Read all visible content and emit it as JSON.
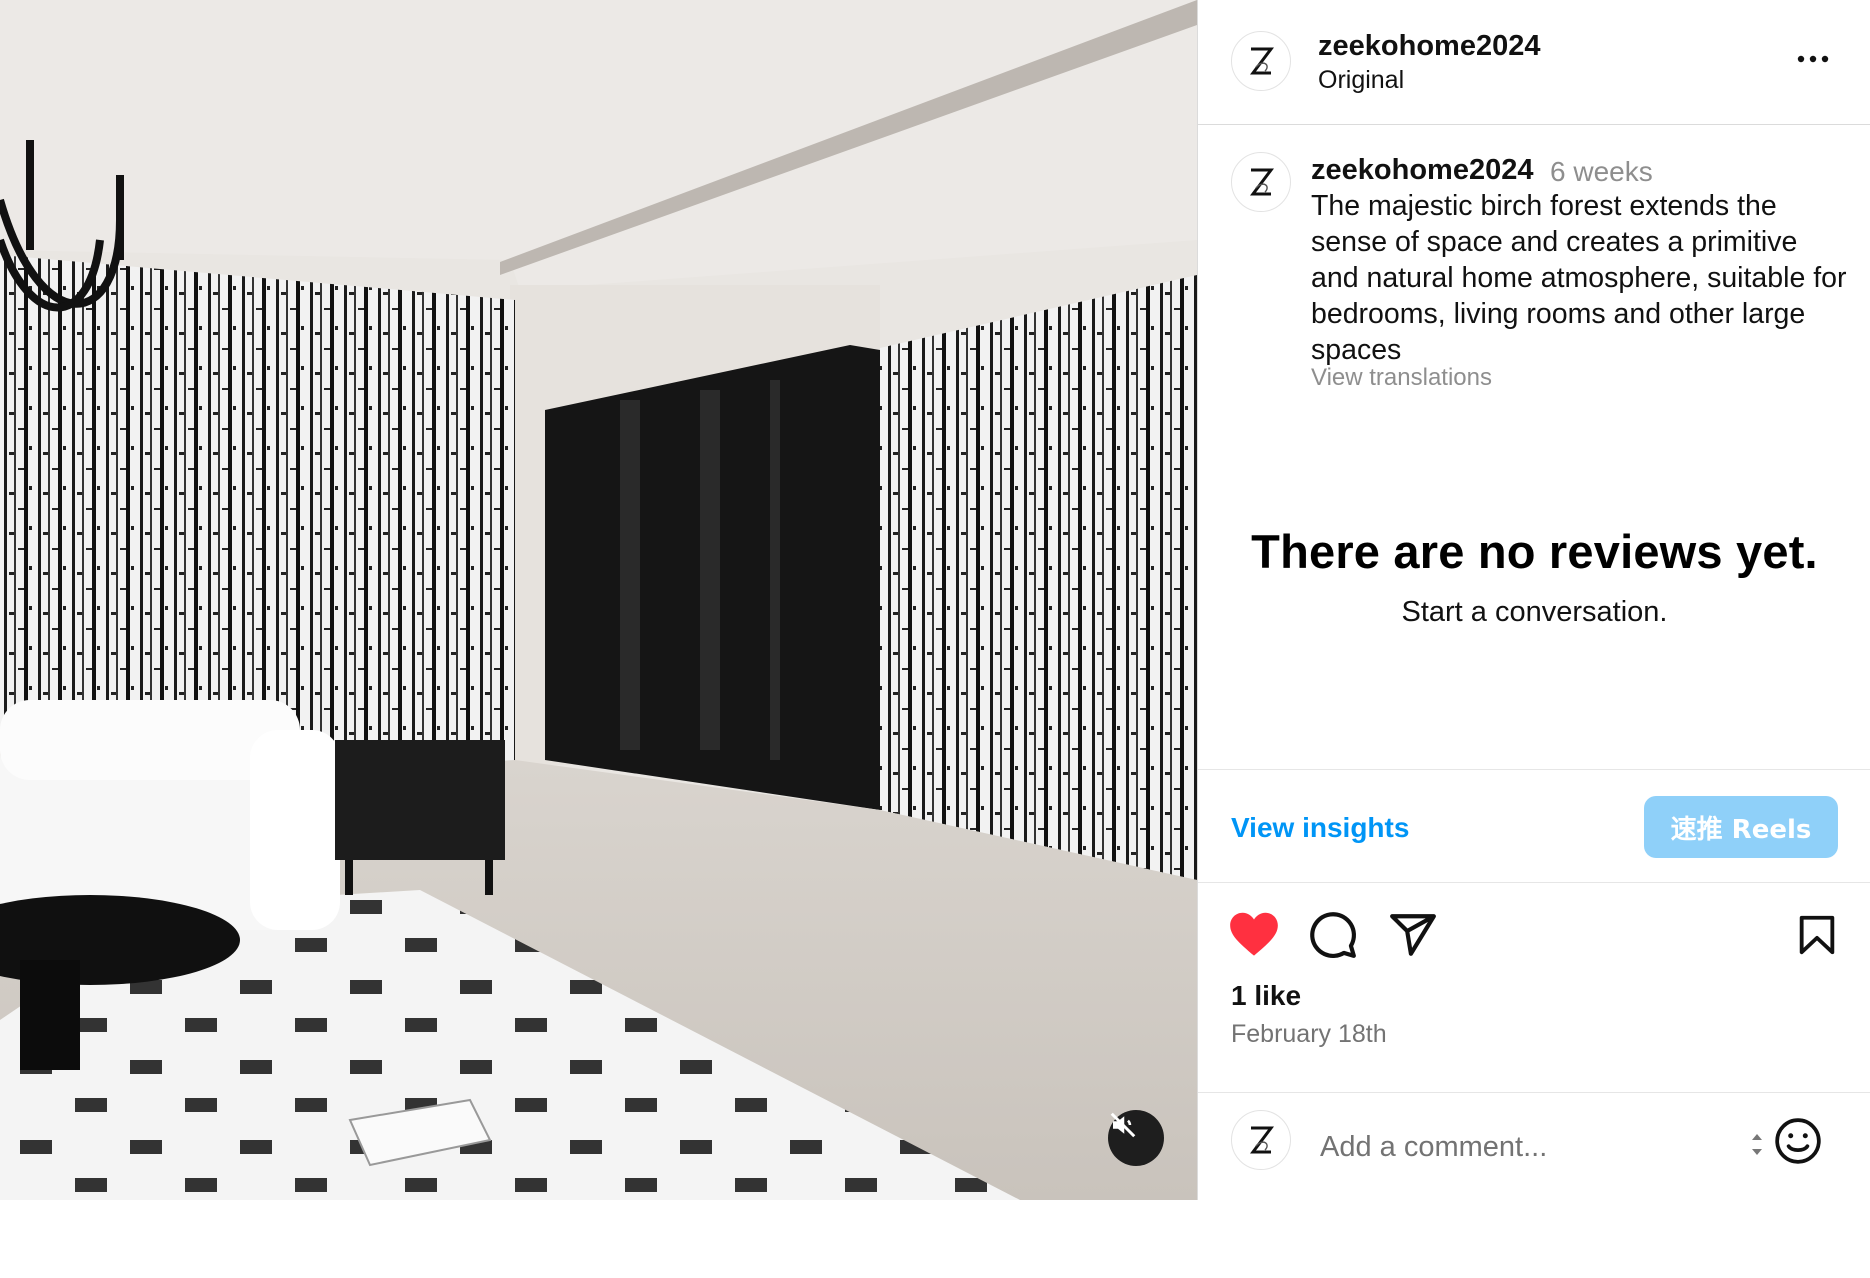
{
  "media": {
    "mute_icon": "speaker-muted-icon"
  },
  "header": {
    "username": "zeekohome2024",
    "subtitle": "Original",
    "avatar_letter": "Z",
    "more_icon": "more-horizontal-icon"
  },
  "caption": {
    "username": "zeekohome2024",
    "time": "6 weeks",
    "text": "The majestic birch forest extends the sense of space and creates a primitive and natural home atmosphere, suitable for bedrooms, living rooms and other large spaces",
    "translate_label": "View translations"
  },
  "empty_state": {
    "title": "There are no reviews yet.",
    "subtitle": "Start a conversation."
  },
  "insights": {
    "link_label": "View insights",
    "boost_label": "速推 Reels"
  },
  "actions": {
    "like_icon": "heart-filled-icon",
    "comment_icon": "comment-icon",
    "share_icon": "send-icon",
    "save_icon": "bookmark-icon",
    "like_color": "#ff3040"
  },
  "stats": {
    "likes": "1 like",
    "date": "February 18th"
  },
  "comment": {
    "placeholder": "Add a comment...",
    "emoji_icon": "emoji-icon",
    "expand_icon": "sort-arrows-icon"
  },
  "colors": {
    "link": "#0095f6",
    "boost_button": "#8fd0f9",
    "muted_text": "#8e8e8e"
  }
}
